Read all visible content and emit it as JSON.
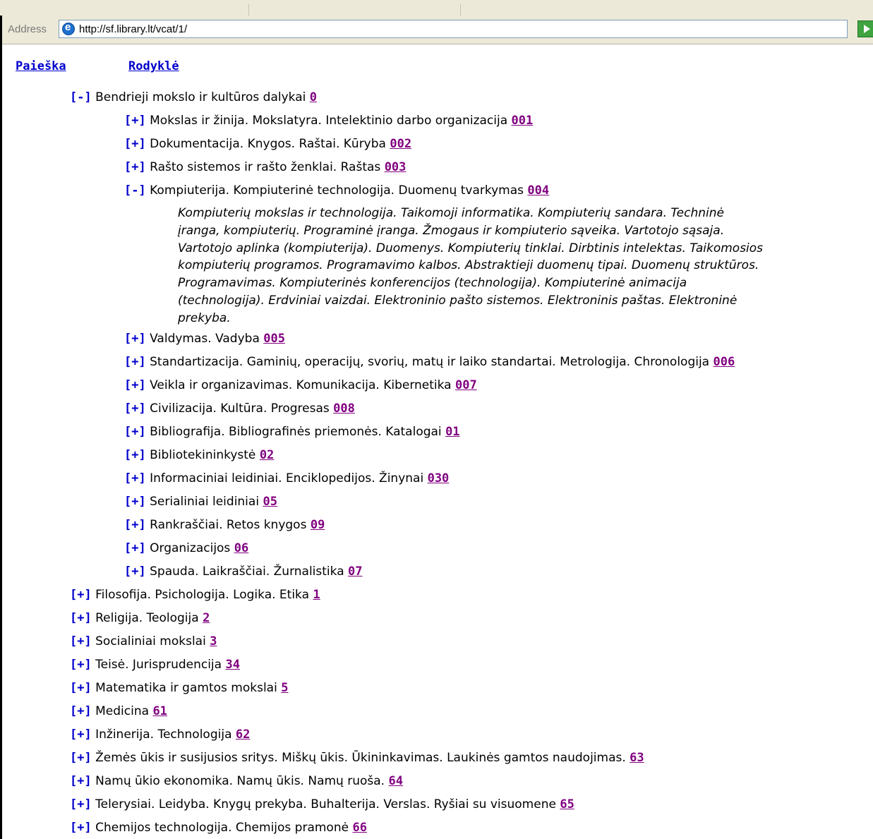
{
  "address_bar": {
    "label": "Address",
    "url": "http://sf.library.lt/vcat/1/"
  },
  "nav": {
    "search": "Paieška",
    "index": "Rodyklė"
  },
  "tree": {
    "root": {
      "toggle": "[-]",
      "label": "Bendrieji mokslo ir kultūros dalykai",
      "code": "0"
    },
    "children": [
      {
        "toggle": "[+]",
        "label": "Mokslas ir žinija. Mokslatyra. Intelektinio darbo organizacija",
        "code": "001"
      },
      {
        "toggle": "[+]",
        "label": "Dokumentacija. Knygos. Raštai. Kūryba",
        "code": "002"
      },
      {
        "toggle": "[+]",
        "label": "Rašto sistemos ir rašto ženklai. Raštas",
        "code": "003"
      },
      {
        "toggle": "[-]",
        "label": "Kompiuterija. Kompiuterinė technologija. Duomenų tvarkymas",
        "code": "004",
        "description_lines": [
          "Kompiuterių mokslas ir technologija. Taikomoji informatika. Kompiuterių sandara. Techninė",
          "įranga, kompiuterių. Programinė įranga. Žmogaus ir kompiuterio sąveika. Vartotojo sąsaja.",
          "Vartotojo aplinka (kompiuterija). Duomenys. Kompiuterių tinklai. Dirbtinis intelektas. Taikomosios",
          "kompiuterių programos. Programavimo kalbos. Abstraktieji duomenų tipai. Duomenų struktūros.",
          "Programavimas. Kompiuterinės konferencijos (technologija). Kompiuterinė animacija",
          "(technologija). Erdviniai vaizdai. Elektroninio pašto sistemos. Elektroninis paštas. Elektroninė",
          "prekyba."
        ]
      },
      {
        "toggle": "[+]",
        "label": "Valdymas. Vadyba",
        "code": "005"
      },
      {
        "toggle": "[+]",
        "label": "Standartizacija. Gaminių, operacijų, svorių, matų ir laiko standartai. Metrologija. Chronologija",
        "code": "006"
      },
      {
        "toggle": "[+]",
        "label": "Veikla ir organizavimas. Komunikacija. Kibernetika",
        "code": "007"
      },
      {
        "toggle": "[+]",
        "label": "Civilizacija. Kultūra. Progresas",
        "code": "008"
      },
      {
        "toggle": "[+]",
        "label": "Bibliografija. Bibliografinės priemonės. Katalogai",
        "code": "01"
      },
      {
        "toggle": "[+]",
        "label": "Bibliotekininkystė",
        "code": "02"
      },
      {
        "toggle": "[+]",
        "label": "Informaciniai leidiniai. Enciklopedijos. Žinynai",
        "code": "030"
      },
      {
        "toggle": "[+]",
        "label": "Serialiniai leidiniai",
        "code": "05"
      },
      {
        "toggle": "[+]",
        "label": "Rankraščiai. Retos knygos",
        "code": "09"
      },
      {
        "toggle": "[+]",
        "label": "Organizacijos",
        "code": "06"
      },
      {
        "toggle": "[+]",
        "label": "Spauda. Laikraščiai. Žurnalistika",
        "code": "07"
      }
    ],
    "top_level": [
      {
        "toggle": "[+]",
        "label": "Filosofija. Psichologija. Logika. Etika",
        "code": "1"
      },
      {
        "toggle": "[+]",
        "label": "Religija. Teologija",
        "code": "2"
      },
      {
        "toggle": "[+]",
        "label": "Socialiniai mokslai",
        "code": "3"
      },
      {
        "toggle": "[+]",
        "label": "Teisė. Jurisprudencija",
        "code": "34"
      },
      {
        "toggle": "[+]",
        "label": "Matematika ir gamtos mokslai",
        "code": "5"
      },
      {
        "toggle": "[+]",
        "label": "Medicina",
        "code": "61"
      },
      {
        "toggle": "[+]",
        "label": "Inžinerija. Technologija",
        "code": "62"
      },
      {
        "toggle": "[+]",
        "label": "Žemės ūkis ir susijusios sritys. Miškų ūkis. Ūkininkavimas. Laukinės gamtos naudojimas.",
        "code": "63"
      },
      {
        "toggle": "[+]",
        "label": "Namų ūkio ekonomika. Namų ūkis. Namų ruoša.",
        "code": "64"
      },
      {
        "toggle": "[+]",
        "label": "Telerysiai. Leidyba. Knygų prekyba. Buhalterija. Verslas. Ryšiai su visuomene",
        "code": "65"
      },
      {
        "toggle": "[+]",
        "label": "Chemijos technologija. Chemijos pramonė",
        "code": "66"
      }
    ]
  },
  "colors": {
    "toggle": "#0000cc",
    "code_link_visited": "#800080",
    "nav_link": "#0000cc"
  }
}
